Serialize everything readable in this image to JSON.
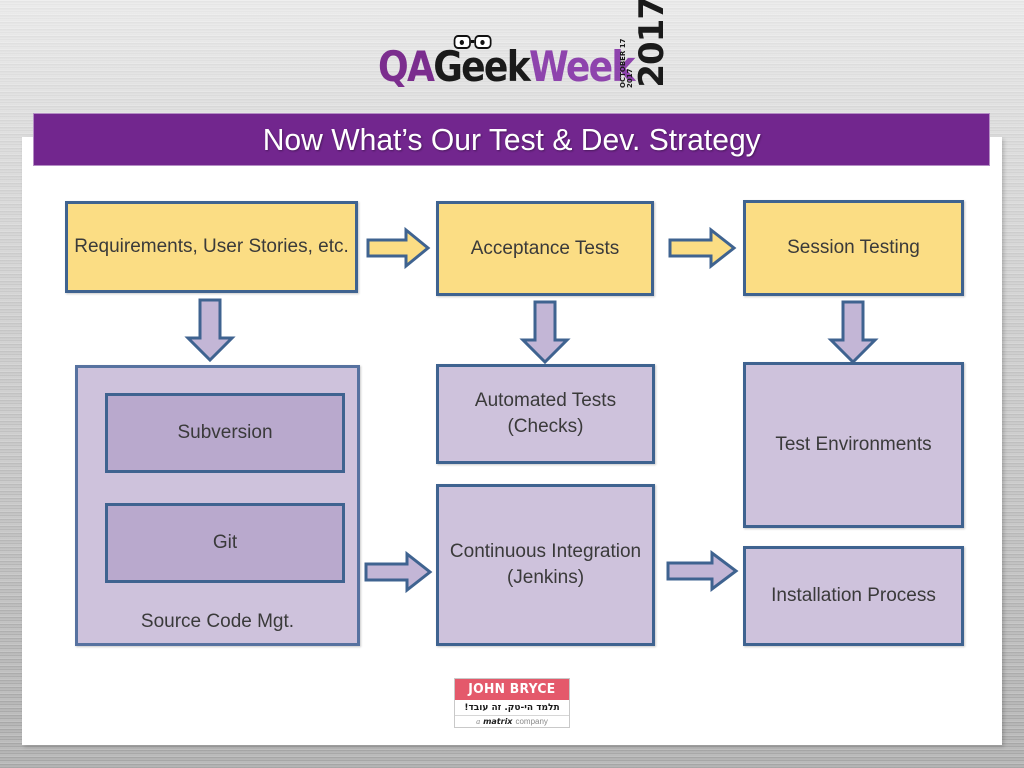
{
  "branding": {
    "logo_qa": "QA",
    "logo_geek": "Geek",
    "logo_week": "Week",
    "logo_year": "2017",
    "logo_year_small": "OCTOBER 17 2017",
    "glasses_icon": "glasses-icon"
  },
  "title": {
    "text": "Now What’s Our Test & Dev. Strategy",
    "background_color": "#72268e",
    "text_color": "#ffffff"
  },
  "colors": {
    "yellow_fill": "#fbdd84",
    "purple_fill": "#cec2dc",
    "purple_inner_fill": "#b9a9cd",
    "box_border": "#3f6390",
    "arrow_purple_fill": "#c3b6d6"
  },
  "diagram": {
    "top_row": [
      {
        "label": "Requirements, User Stories, etc.",
        "style": "yellow"
      },
      {
        "label": "Acceptance Tests",
        "style": "yellow"
      },
      {
        "label": "Session Testing",
        "style": "yellow"
      }
    ],
    "source_code_group": {
      "label": "Source Code Mgt.",
      "items": [
        {
          "label": "Subversion"
        },
        {
          "label": "Git"
        }
      ]
    },
    "middle_column": [
      {
        "label": "Automated Tests (Checks)",
        "style": "purple"
      },
      {
        "label": "Continuous Integration (Jenkins)",
        "style": "purple"
      }
    ],
    "right_column": [
      {
        "label": "Test Environments",
        "style": "purple"
      },
      {
        "label": "Installation Process",
        "style": "purple"
      }
    ],
    "arrows": [
      {
        "name": "arrow-requirements-to-acceptance",
        "direction": "right",
        "color": "yellow"
      },
      {
        "name": "arrow-acceptance-to-session",
        "direction": "right",
        "color": "yellow"
      },
      {
        "name": "arrow-requirements-to-source-code",
        "direction": "down",
        "color": "purple"
      },
      {
        "name": "arrow-acceptance-to-automated-tests",
        "direction": "down",
        "color": "purple"
      },
      {
        "name": "arrow-session-to-test-environments",
        "direction": "down",
        "color": "purple"
      },
      {
        "name": "arrow-source-code-to-continuous-integration",
        "direction": "right",
        "color": "purple"
      },
      {
        "name": "arrow-continuous-integration-to-installation",
        "direction": "right",
        "color": "purple"
      }
    ]
  },
  "footer_logo": {
    "name": "JOHN BRYCE",
    "tagline_he": "תלמד הי-טק. זה עובד!",
    "sub_a": "a",
    "sub_brand": "matrix",
    "sub_company": "company"
  }
}
